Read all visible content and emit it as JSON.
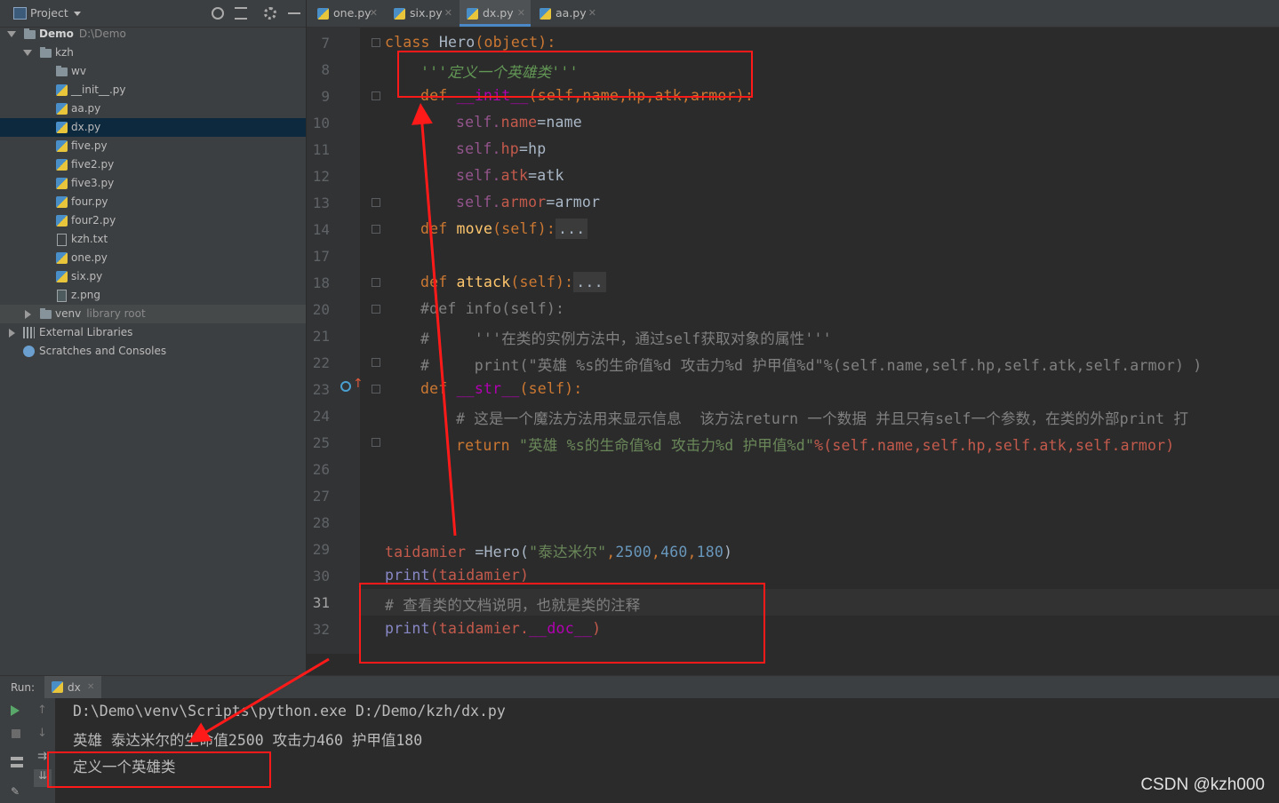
{
  "project": {
    "title": "Project",
    "tree": [
      {
        "label": "Demo",
        "path": "D:\\Demo"
      },
      {
        "label": "kzh"
      },
      {
        "label": "wv"
      },
      {
        "label": "__init__.py"
      },
      {
        "label": "aa.py"
      },
      {
        "label": "dx.py"
      },
      {
        "label": "five.py"
      },
      {
        "label": "five2.py"
      },
      {
        "label": "five3.py"
      },
      {
        "label": "four.py"
      },
      {
        "label": "four2.py"
      },
      {
        "label": "kzh.txt"
      },
      {
        "label": "one.py"
      },
      {
        "label": "six.py"
      },
      {
        "label": "z.png"
      },
      {
        "label": "venv",
        "path": "library root"
      },
      {
        "label": "External Libraries"
      },
      {
        "label": "Scratches and Consoles"
      }
    ]
  },
  "tabs": [
    {
      "label": "one.py"
    },
    {
      "label": "six.py"
    },
    {
      "label": "dx.py"
    },
    {
      "label": "aa.py"
    }
  ],
  "editor": {
    "line_numbers": [
      "7",
      "8",
      "9",
      "10",
      "11",
      "12",
      "13",
      "14",
      "17",
      "18",
      "20",
      "21",
      "22",
      "23",
      "24",
      "25",
      "26",
      "27",
      "28",
      "29",
      "30",
      "31",
      "32"
    ],
    "lines": {
      "l7a": "class ",
      "l7b": "Hero",
      "l7c": "(object):",
      "l8": "'''定义一个英雄类'''",
      "l9a": "def ",
      "l9b": "__init__",
      "l9c": "(self,name,hp,atk,armor):",
      "l10a": "self.",
      "l10b": "name",
      "l10c": "=name",
      "l11a": "self.",
      "l11b": "hp",
      "l11c": "=hp",
      "l12a": "self.",
      "l12b": "atk",
      "l12c": "=atk",
      "l13a": "self.",
      "l13b": "armor",
      "l13c": "=armor",
      "l14a": "def ",
      "l14b": "move",
      "l14c": "(self):",
      "l14d": "...",
      "l18a": "def ",
      "l18b": "attack",
      "l18c": "(self):",
      "l18d": "...",
      "l20": "#def info(self):",
      "l21": "#     '''在类的实例方法中，通过self获取对象的属性'''",
      "l22": "#     print(\"英雄 %s的生命值%d 攻击力%d 护甲值%d\"%(self.name,self.hp,self.atk,self.armor) )",
      "l23a": "def ",
      "l23b": "__str__",
      "l23c": "(self):",
      "l24": "# 这是一个魔法方法用来显示信息  该方法return 一个数据 并且只有self一个参数，在类的外部print 打",
      "l25a": "return ",
      "l25b": "\"英雄 %s的生命值%d 攻击力%d 护甲值%d\"",
      "l25c": "%(self.name,self.hp,self.atk,self.armor)",
      "l29a": "taidamier ",
      "l29b": "=Hero(",
      "l29c": "\"泰达米尔\"",
      "l29d": ",",
      "l29e": "2500",
      "l29f": ",",
      "l29g": "460",
      "l29h": ",",
      "l29i": "180",
      "l29j": ")",
      "l30a": "print",
      "l30b": "(taidamier)",
      "l31": "# 查看类的文档说明，也就是类的注释",
      "l32a": "print",
      "l32b": "(taidamier.",
      "l32c": "__doc__",
      "l32d": ")"
    }
  },
  "run": {
    "label": "Run:",
    "config": "dx",
    "output": [
      "D:\\Demo\\venv\\Scripts\\python.exe D:/Demo/kzh/dx.py",
      "英雄 泰达米尔的生命值2500 攻击力460 护甲值180",
      "定义一个英雄类"
    ]
  },
  "watermark": "CSDN @kzh000",
  "colors": {
    "annotation": "#ff1a1a",
    "selection": "#0d293e",
    "accent": "#4a88c7"
  }
}
